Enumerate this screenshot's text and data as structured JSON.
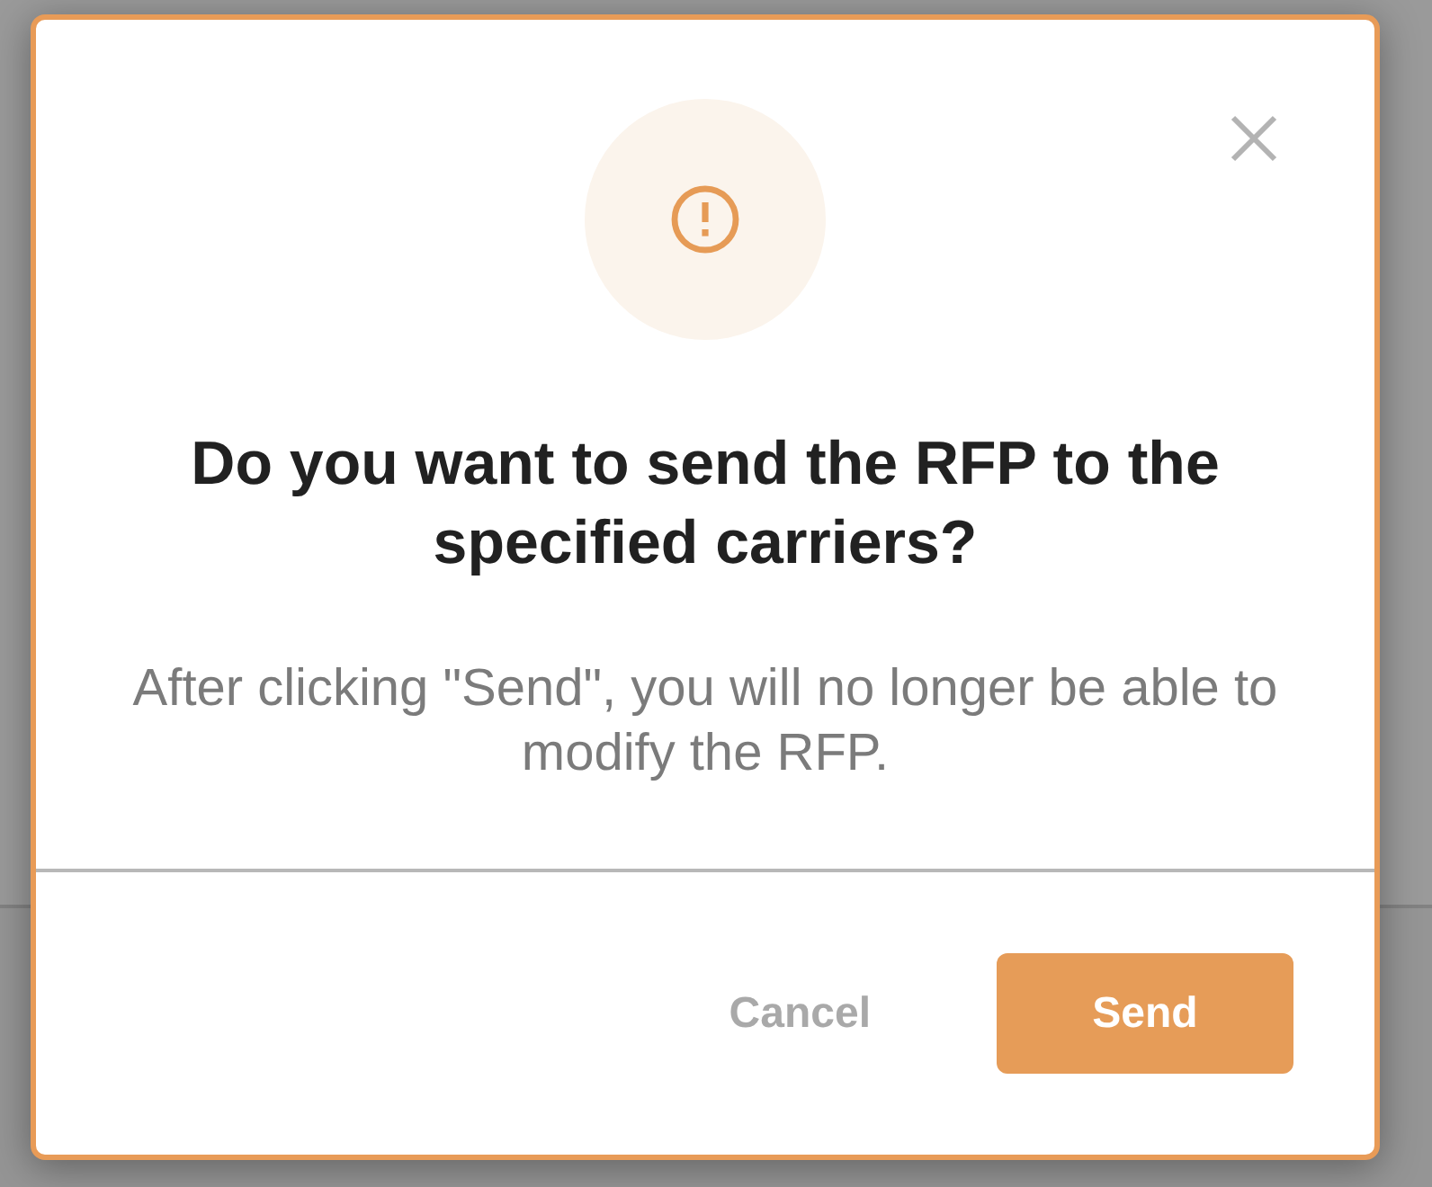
{
  "dialog": {
    "title": "Do you want to send the RFP to the specified carriers?",
    "message": "After clicking \"Send\", you will no longer be able to modify the RFP.",
    "buttons": [
      {
        "label": "Cancel",
        "kind": "text"
      },
      {
        "label": "Send",
        "kind": "primary"
      }
    ]
  }
}
